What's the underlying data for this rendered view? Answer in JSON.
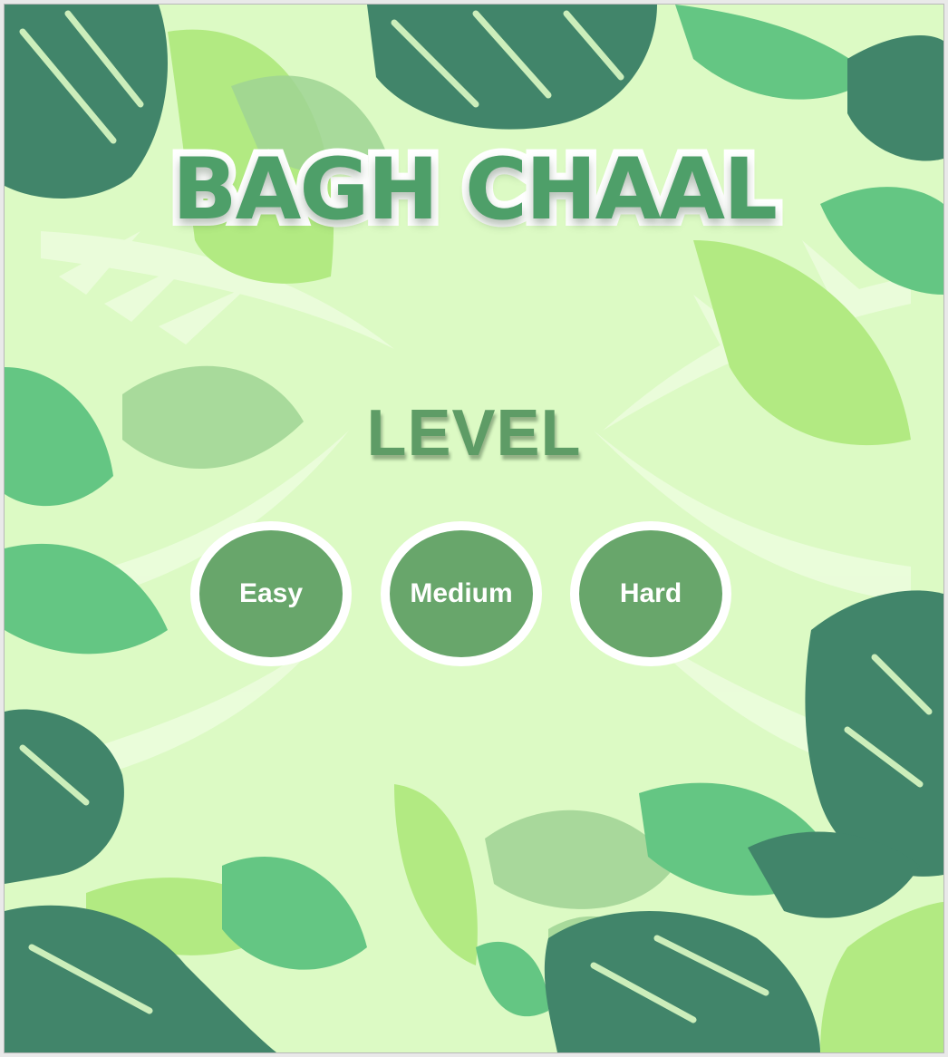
{
  "game": {
    "title": "BAGH CHAAL",
    "level_heading": "LEVEL"
  },
  "levels": {
    "easy_label": "Easy",
    "medium_label": "Medium",
    "hard_label": "Hard"
  },
  "colors": {
    "background": "#dcfac4",
    "title_fill": "#4e9f69",
    "button_fill": "#68a66b",
    "leaf_dark": "#41856a",
    "leaf_mid": "#64c683",
    "leaf_light": "#b2ea82",
    "leaf_pale": "#9fd394"
  }
}
